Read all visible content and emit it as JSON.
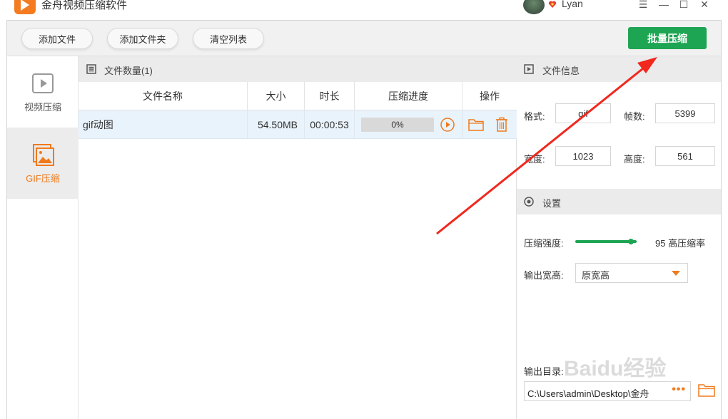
{
  "app": {
    "title": "金舟视频压缩软件",
    "user_name": "Lyan"
  },
  "window_controls": {
    "menu": "☰",
    "minimize": "—",
    "maximize": "☐",
    "close": "✕"
  },
  "toolbar": {
    "add_file": "添加文件",
    "add_folder": "添加文件夹",
    "clear_list": "清空列表",
    "batch_compress": "批量压缩"
  },
  "sidebar": {
    "items": [
      {
        "label": "视频压缩",
        "icon": "video-icon"
      },
      {
        "label": "GIF压缩",
        "icon": "image-icon"
      }
    ]
  },
  "file_list": {
    "header": "文件数量(1)",
    "columns": [
      "文件名称",
      "大小",
      "时长",
      "压缩进度",
      "操作"
    ],
    "rows": [
      {
        "name": "gif动图",
        "size": "54.50MB",
        "duration": "00:00:53",
        "progress_text": "0%",
        "progress": 0
      }
    ]
  },
  "file_info": {
    "title": "文件信息",
    "format_label": "格式:",
    "format_value": "gif",
    "frames_label": "帧数:",
    "frames_value": "5399",
    "width_label": "宽度:",
    "width_value": "1023",
    "height_label": "高度:",
    "height_value": "561"
  },
  "settings": {
    "title": "设置",
    "strength_label": "压缩强度:",
    "strength_value": 95,
    "strength_text": "95 高压缩率",
    "output_size_label": "输出宽高:",
    "output_size_value": "原宽高",
    "output_dir_label": "输出目录:",
    "output_dir_value": "C:\\Users\\admin\\Desktop\\金舟",
    "browse_dots": "•••"
  },
  "watermark": "Baidu经验",
  "colors": {
    "accent_green": "#1ea553",
    "accent_orange": "#f07a1d",
    "annotation_red": "#f0281e"
  }
}
